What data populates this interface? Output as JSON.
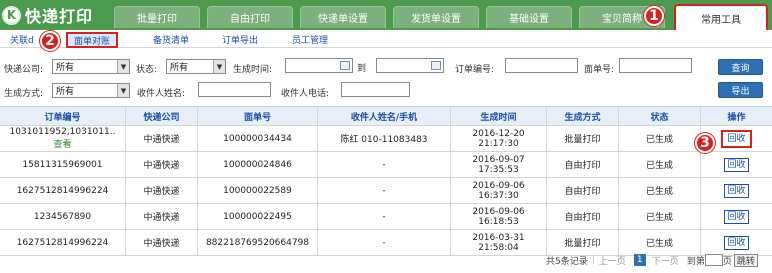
{
  "app": {
    "logo_letter": "K",
    "title": "快递打印"
  },
  "main_tabs": [
    {
      "label": "批量打印",
      "active": false
    },
    {
      "label": "自由打印",
      "active": false
    },
    {
      "label": "快递单设置",
      "active": false
    },
    {
      "label": "发货单设置",
      "active": false
    },
    {
      "label": "基础设置",
      "active": false
    },
    {
      "label": "宝贝简称",
      "active": false
    },
    {
      "label": "常用工具",
      "active": true
    }
  ],
  "sub_tabs": [
    {
      "label": "关联d",
      "active": false
    },
    {
      "label": "面单对账",
      "active": true
    },
    {
      "label": "备货清单",
      "active": false
    },
    {
      "label": "订单导出",
      "active": false
    },
    {
      "label": "员工管理",
      "active": false
    }
  ],
  "step_badges": [
    "1",
    "2",
    "3"
  ],
  "filters": {
    "express_company_label": "快递公司:",
    "express_company_value": "所有",
    "status_label": "状态:",
    "status_value": "所有",
    "gen_time_label": "生成时间:",
    "to_label": "到",
    "order_no_label": "订单编号:",
    "waybill_no_label": "面单号:",
    "gen_method_label": "生成方式:",
    "gen_method_value": "所有",
    "recipient_name_label": "收件人姓名:",
    "recipient_phone_label": "收件人电话:",
    "query_button": "查询",
    "export_button": "导出"
  },
  "table": {
    "columns": [
      "订单编号",
      "快递公司",
      "面单号",
      "收件人姓名/手机",
      "生成时间",
      "生成方式",
      "状态",
      "操作"
    ],
    "view_label": "查看",
    "action_label": "回收",
    "rows": [
      {
        "order_no": "1031011952,1031011..",
        "has_view": true,
        "company": "中通快递",
        "waybill": "100000034434",
        "recipient": "陈红 010-11083483",
        "time": "2016-12-20 21:17:30",
        "method": "批量打印",
        "status": "已生成"
      },
      {
        "order_no": "15811315969001",
        "has_view": false,
        "company": "中通快递",
        "waybill": "100000024846",
        "recipient": "-",
        "time": "2016-09-07 17:35:53",
        "method": "自由打印",
        "status": "已生成"
      },
      {
        "order_no": "1627512814996224",
        "has_view": false,
        "company": "中通快递",
        "waybill": "100000022589",
        "recipient": "-",
        "time": "2016-09-06 16:37:30",
        "method": "自由打印",
        "status": "已生成"
      },
      {
        "order_no": "1234567890",
        "has_view": false,
        "company": "中通快递",
        "waybill": "100000022495",
        "recipient": "-",
        "time": "2016-09-06 16:18:53",
        "method": "自由打印",
        "status": "已生成"
      },
      {
        "order_no": "1627512814996224",
        "has_view": false,
        "company": "中通快递",
        "waybill": "882218769520664798",
        "recipient": "-",
        "time": "2016-03-31 21:58:04",
        "method": "批量打印",
        "status": "已生成"
      }
    ]
  },
  "pager": {
    "total_text": "共5条记录",
    "prev": "上一页",
    "current_page": "1",
    "next": "下一页",
    "goto_prefix": "到第",
    "goto_suffix": "页",
    "jump_button": "跳转"
  },
  "colors": {
    "brand_green": "#4b9a4e",
    "accent_blue": "#2f6fb3",
    "highlight_red": "#d92020"
  }
}
